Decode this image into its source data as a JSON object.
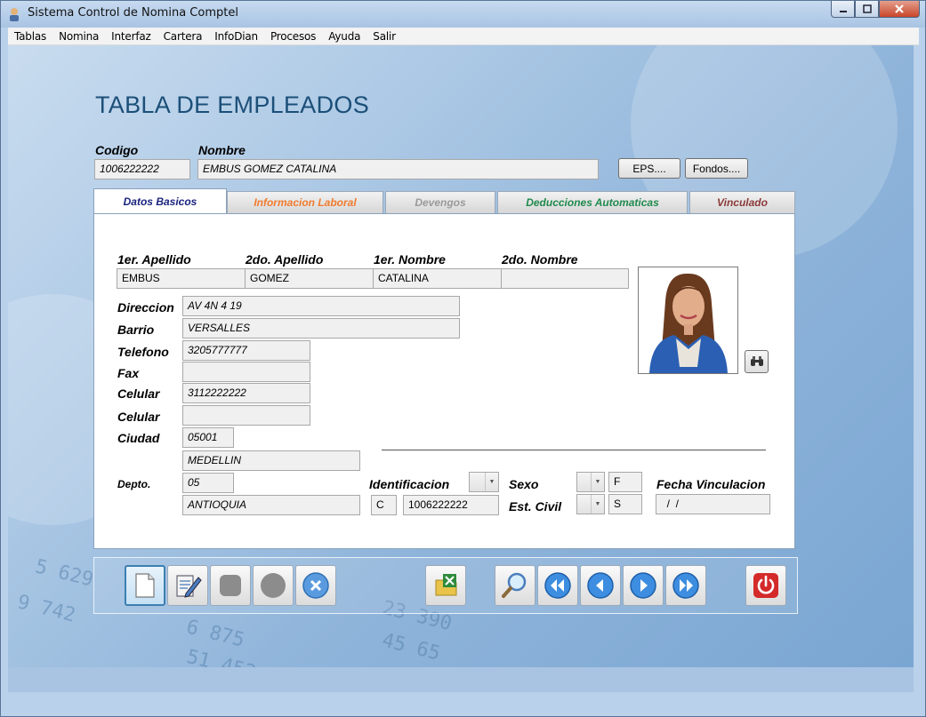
{
  "window": {
    "title": "Sistema Control de Nomina Comptel"
  },
  "menu": [
    "Tablas",
    "Nomina",
    "Interfaz",
    "Cartera",
    "InfoDian",
    "Procesos",
    "Ayuda",
    "Salir"
  ],
  "page": {
    "title": "TABLA DE EMPLEADOS"
  },
  "header": {
    "codigo_label": "Codigo",
    "codigo_value": "1006222222",
    "nombre_label": "Nombre",
    "nombre_value": "EMBUS GOMEZ CATALINA",
    "eps_button": "EPS....",
    "fondos_button": "Fondos...."
  },
  "tabs": [
    {
      "label": "Datos Basicos",
      "color": "#1a237e"
    },
    {
      "label": "Informacion Laboral",
      "color": "#f07b2e"
    },
    {
      "label": "Devengos",
      "color": "#9a9a9a"
    },
    {
      "label": "Deducciones Automaticas",
      "color": "#1f8a4c"
    },
    {
      "label": "Vinculado",
      "color": "#8b3a3a"
    }
  ],
  "form": {
    "apellido1_label": "1er. Apellido",
    "apellido1": "EMBUS",
    "apellido2_label": "2do. Apellido",
    "apellido2": "GOMEZ",
    "nombre1_label": "1er. Nombre",
    "nombre1": "CATALINA",
    "nombre2_label": "2do. Nombre",
    "nombre2": "",
    "direccion_label": "Direccion",
    "direccion": "AV 4N 4 19",
    "barrio_label": "Barrio",
    "barrio": "VERSALLES",
    "telefono_label": "Telefono",
    "telefono": "3205777777",
    "fax_label": "Fax",
    "fax": "",
    "celular_label": "Celular",
    "celular": "3112222222",
    "celular2_label": "Celular",
    "celular2": "",
    "ciudad_label": "Ciudad",
    "ciudad_code": "05001",
    "ciudad_name": "MEDELLIN",
    "depto_label": "Depto.",
    "depto_code": "05",
    "depto_name": "ANTIOQUIA",
    "identificacion_label": "Identificacion",
    "id_tipo": "C",
    "id_numero": "1006222222",
    "sexo_label": "Sexo",
    "sexo": "F",
    "estcivil_label": "Est. Civil",
    "estcivil": "S",
    "fecha_vinc_label": "Fecha Vinculacion",
    "fecha_vinc": "  /  /"
  },
  "toolbar_icons": [
    "new-icon",
    "edit-icon",
    "save-icon",
    "undo-icon",
    "delete-icon",
    "excel-icon",
    "search-icon",
    "first-icon",
    "prev-icon",
    "next-icon",
    "last-icon",
    "power-icon"
  ],
  "colors": {
    "title": "#1b4f78",
    "accent": "#2f7fc4",
    "power": "#d42a2a"
  }
}
